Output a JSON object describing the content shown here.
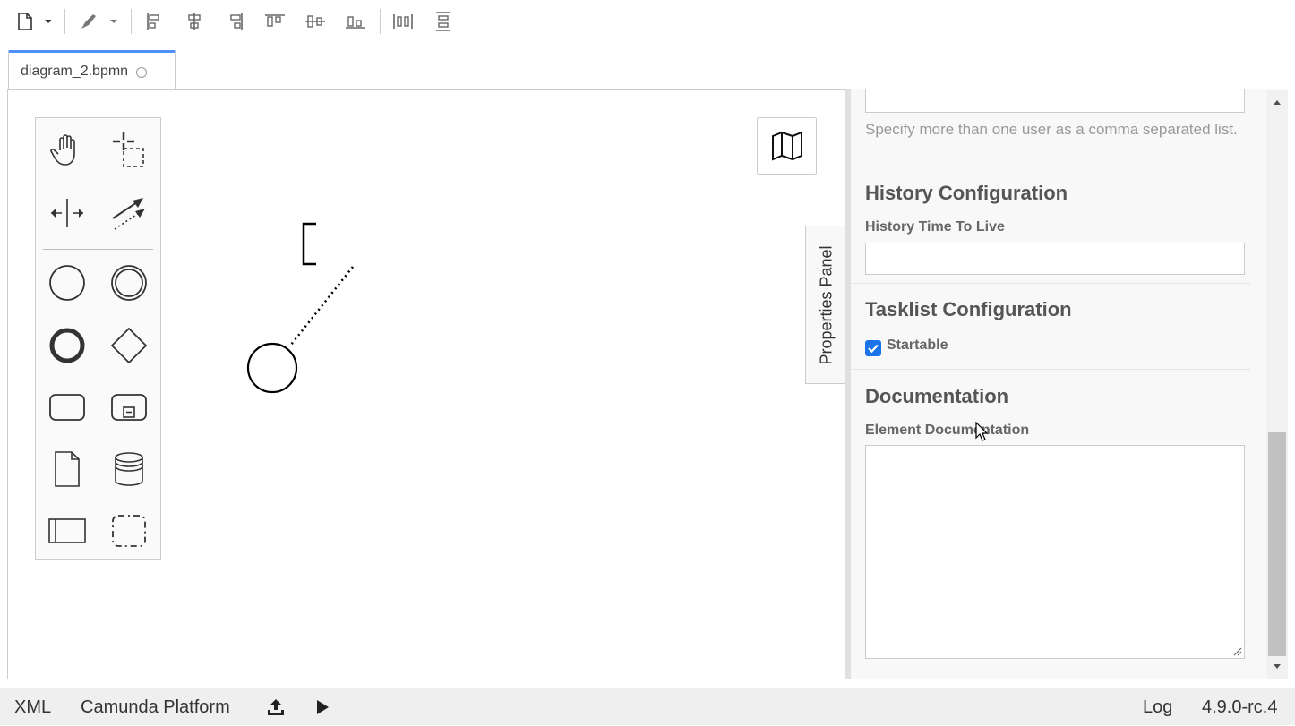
{
  "tab": {
    "title": "diagram_2.bpmn"
  },
  "props": {
    "candidate_users_hint": "Specify more than one user as a comma separated list.",
    "history": {
      "title": "History Configuration",
      "ttl_label": "History Time To Live",
      "ttl_value": ""
    },
    "tasklist": {
      "title": "Tasklist Configuration",
      "startable_label": "Startable",
      "startable_checked": true
    },
    "documentation": {
      "title": "Documentation",
      "element_label": "Element Documentation",
      "element_value": ""
    }
  },
  "properties_toggle": {
    "label": "Properties Panel"
  },
  "statusbar": {
    "xml": "XML",
    "platform": "Camunda Platform",
    "log": "Log",
    "version": "4.9.0-rc.4"
  },
  "colors": {
    "accent": "#4d90fe",
    "checkbox": "#1a73e8"
  }
}
